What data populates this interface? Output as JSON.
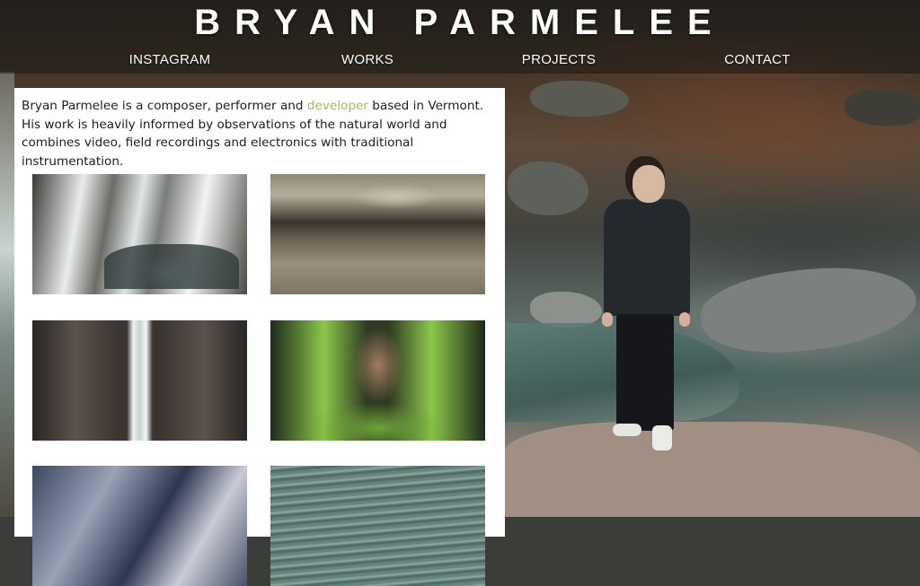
{
  "site": {
    "title": "BRYAN PARMELEE"
  },
  "nav": {
    "items": [
      {
        "label": "INSTAGRAM"
      },
      {
        "label": "WORKS"
      },
      {
        "label": "PROJECTS"
      },
      {
        "label": "CONTACT"
      }
    ]
  },
  "bio": {
    "before_link": "Bryan Parmelee is a composer, performer and ",
    "link_text": "developer",
    "after_link": " based in Vermont. His work is heavily informed by observations of the natural world and combines video, field recordings and electronics with traditional instrumentation."
  },
  "colors": {
    "link_accent": "#93c05a",
    "panel_background": "#ffffff",
    "title_text": "#ffffff"
  },
  "gallery": {
    "thumbnails": [
      {
        "icon": "snowy-stream-thumbnail"
      },
      {
        "icon": "riverbed-stones-thumbnail"
      },
      {
        "icon": "mirrored-waterfall-thumbnail"
      },
      {
        "icon": "mirrored-green-plants-thumbnail"
      },
      {
        "icon": "blue-rocks-thumbnail"
      },
      {
        "icon": "rippling-water-thumbnail"
      }
    ]
  }
}
